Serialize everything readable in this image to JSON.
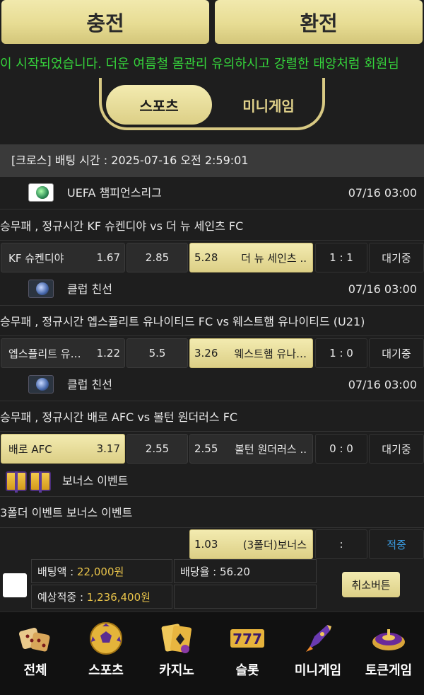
{
  "top_buttons": {
    "charge": "충전",
    "exchange": "환전"
  },
  "marquee": "이 시작되었습니다. 더운 여름철 몸관리 유의하시고 강렬한 태양처럼 회원님",
  "categories": {
    "sports": "스포츠",
    "minigame": "미니게임"
  },
  "slip_header": "[크로스] 배팅 시간 : 2025-07-16 오전 2:59:01",
  "matches": [
    {
      "league": "UEFA 챔피언스리그",
      "league_time": "07/16 03:00",
      "title": "승무패 , 정규시간 KF 슈켄디야 vs 더 뉴 세인츠 FC",
      "home_team": "KF 슈켄디야",
      "home_odds": "1.67",
      "draw_odds": "2.85",
      "away_odds": "5.28",
      "away_team": "더 뉴 세인츠 ..",
      "score": "1 : 1",
      "status": "대기중"
    },
    {
      "league": "클럽 친선",
      "league_time": "07/16 03:00",
      "title": "승무패 , 정규시간 엡스플리트 유나이티드 FC vs 웨스트햄 유나이티드 (U21)",
      "home_team": "엡스플리트 유…",
      "home_odds": "1.22",
      "draw_odds": "5.5",
      "away_odds": "3.26",
      "away_team": "웨스트햄 유나…",
      "score": "1 : 0",
      "status": "대기중"
    },
    {
      "league": "클럽 친선",
      "league_time": "07/16 03:00",
      "title": "승무패 , 정규시간 배로 AFC vs 볼턴 원더러스 FC",
      "home_team": "배로 AFC",
      "home_odds": "3.17",
      "draw_odds": "2.55",
      "away_odds": "2.55",
      "away_team": "볼턴 원더러스 ..",
      "score": "0 : 0",
      "status": "대기중"
    }
  ],
  "bonus": {
    "label": "보너스 이벤트",
    "title": "3폴더 이벤트 보너스 이벤트",
    "odds": "1.03",
    "name": "(3폴더)보너스",
    "score": ":",
    "status": "적중"
  },
  "slip": {
    "bet_amount_label": "배팅액 : ",
    "bet_amount": "22,000원",
    "odds_label": "배당율 : ",
    "odds": "56.20",
    "expected_label": "예상적중 : ",
    "expected": "1,236,400원",
    "cancel": "취소버튼"
  },
  "nav": [
    "전체",
    "스포츠",
    "카지노",
    "슬롯",
    "미니게임",
    "토큰게임"
  ],
  "slot_text": "777",
  "colors": {
    "gold": "#dccf86",
    "green_marquee": "#35d23b",
    "hit_blue": "#3a9be0"
  }
}
